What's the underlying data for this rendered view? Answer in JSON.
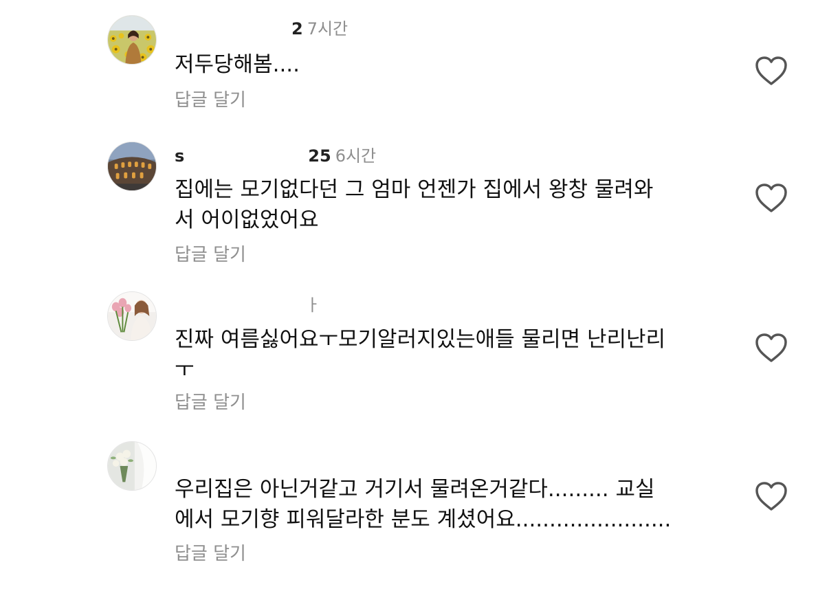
{
  "comments": [
    {
      "username_visible": "2",
      "time": "7시간",
      "lines": [
        "저두당해봄...."
      ],
      "reply_label": "답글 달기"
    },
    {
      "username_visible": "s",
      "username_tail": "25",
      "time": "6시간",
      "lines": [
        "집에는 모기없다던 그 엄마 언젠가 집에서 왕창 물려와",
        "서 어이없었어요"
      ],
      "reply_label": "답글 달기"
    },
    {
      "username_visible": "ㅏ",
      "time": "",
      "lines": [
        "진짜 여름싫어요ㅜ모기알러지있는애들 물리면 난리난리",
        "ㅜ"
      ],
      "reply_label": "답글 달기"
    },
    {
      "username_visible": "",
      "time": "",
      "lines": [
        "우리집은 아닌거같고 거기서 물려온거같다......... 교실",
        "에서 모기향 피워달라한 분도 계셨어요......................."
      ],
      "reply_label": "답글 달기"
    }
  ],
  "colors": {
    "text": "#111111",
    "secondary": "#8e8e8e",
    "icon": "#555555"
  },
  "icons": {
    "like": "heart-outline-icon"
  }
}
